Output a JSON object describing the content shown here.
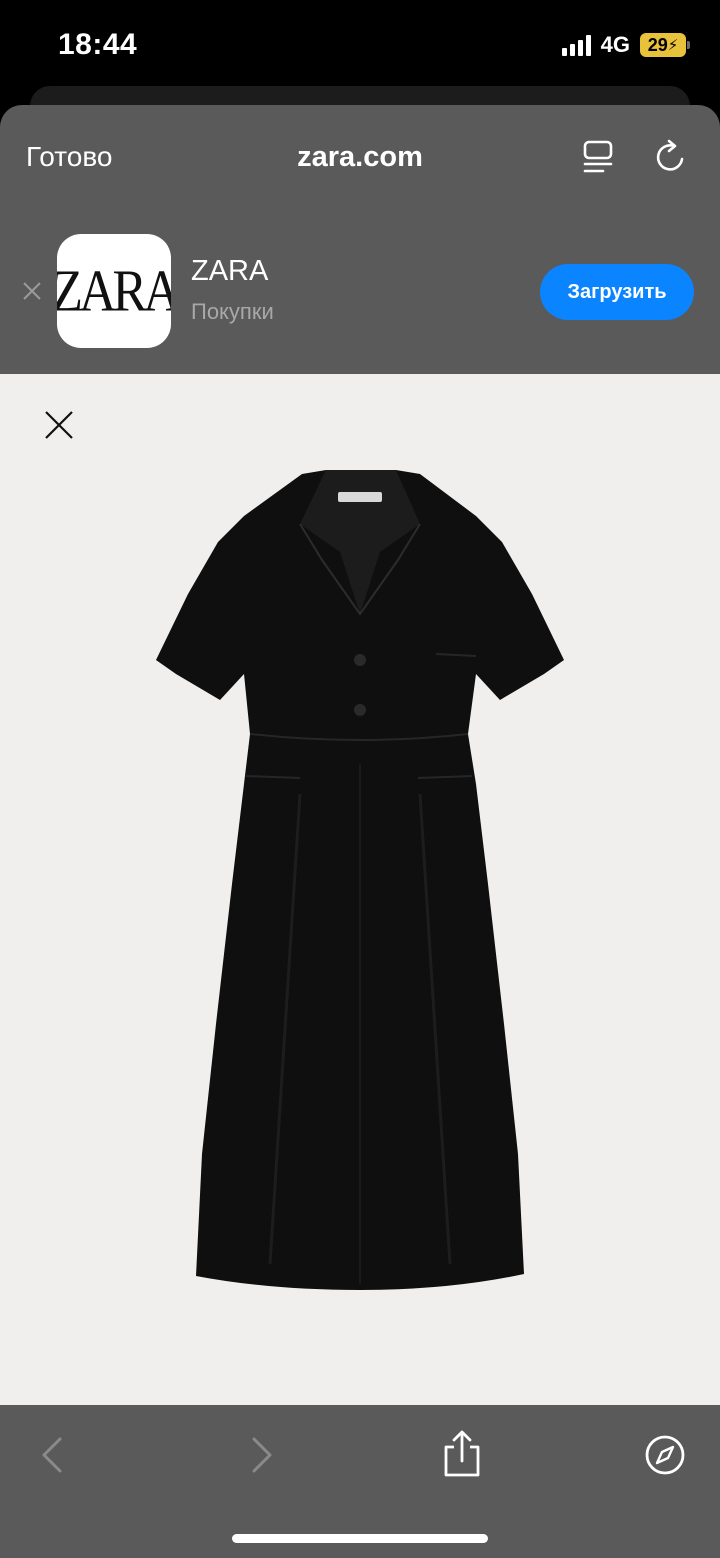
{
  "status_bar": {
    "time": "18:44",
    "network": "4G",
    "battery": "29",
    "battery_color": "#e8c23a"
  },
  "browser": {
    "done_label": "Готово",
    "url": "zara.com",
    "icons": [
      "reader-view-icon",
      "reload-icon"
    ]
  },
  "app_banner": {
    "icon_text": "ZARA",
    "app_name": "ZARA",
    "category": "Покупки",
    "get_button_label": "Загрузить",
    "button_color": "#0a84ff"
  },
  "content": {
    "background": "#f0efed",
    "close_icon": "close-icon",
    "product_image": "black-short-sleeve-midi-shirt-dress"
  },
  "toolbar": {
    "icons": [
      "back-chevron-icon",
      "forward-chevron-icon",
      "share-icon",
      "compass-icon"
    ]
  }
}
